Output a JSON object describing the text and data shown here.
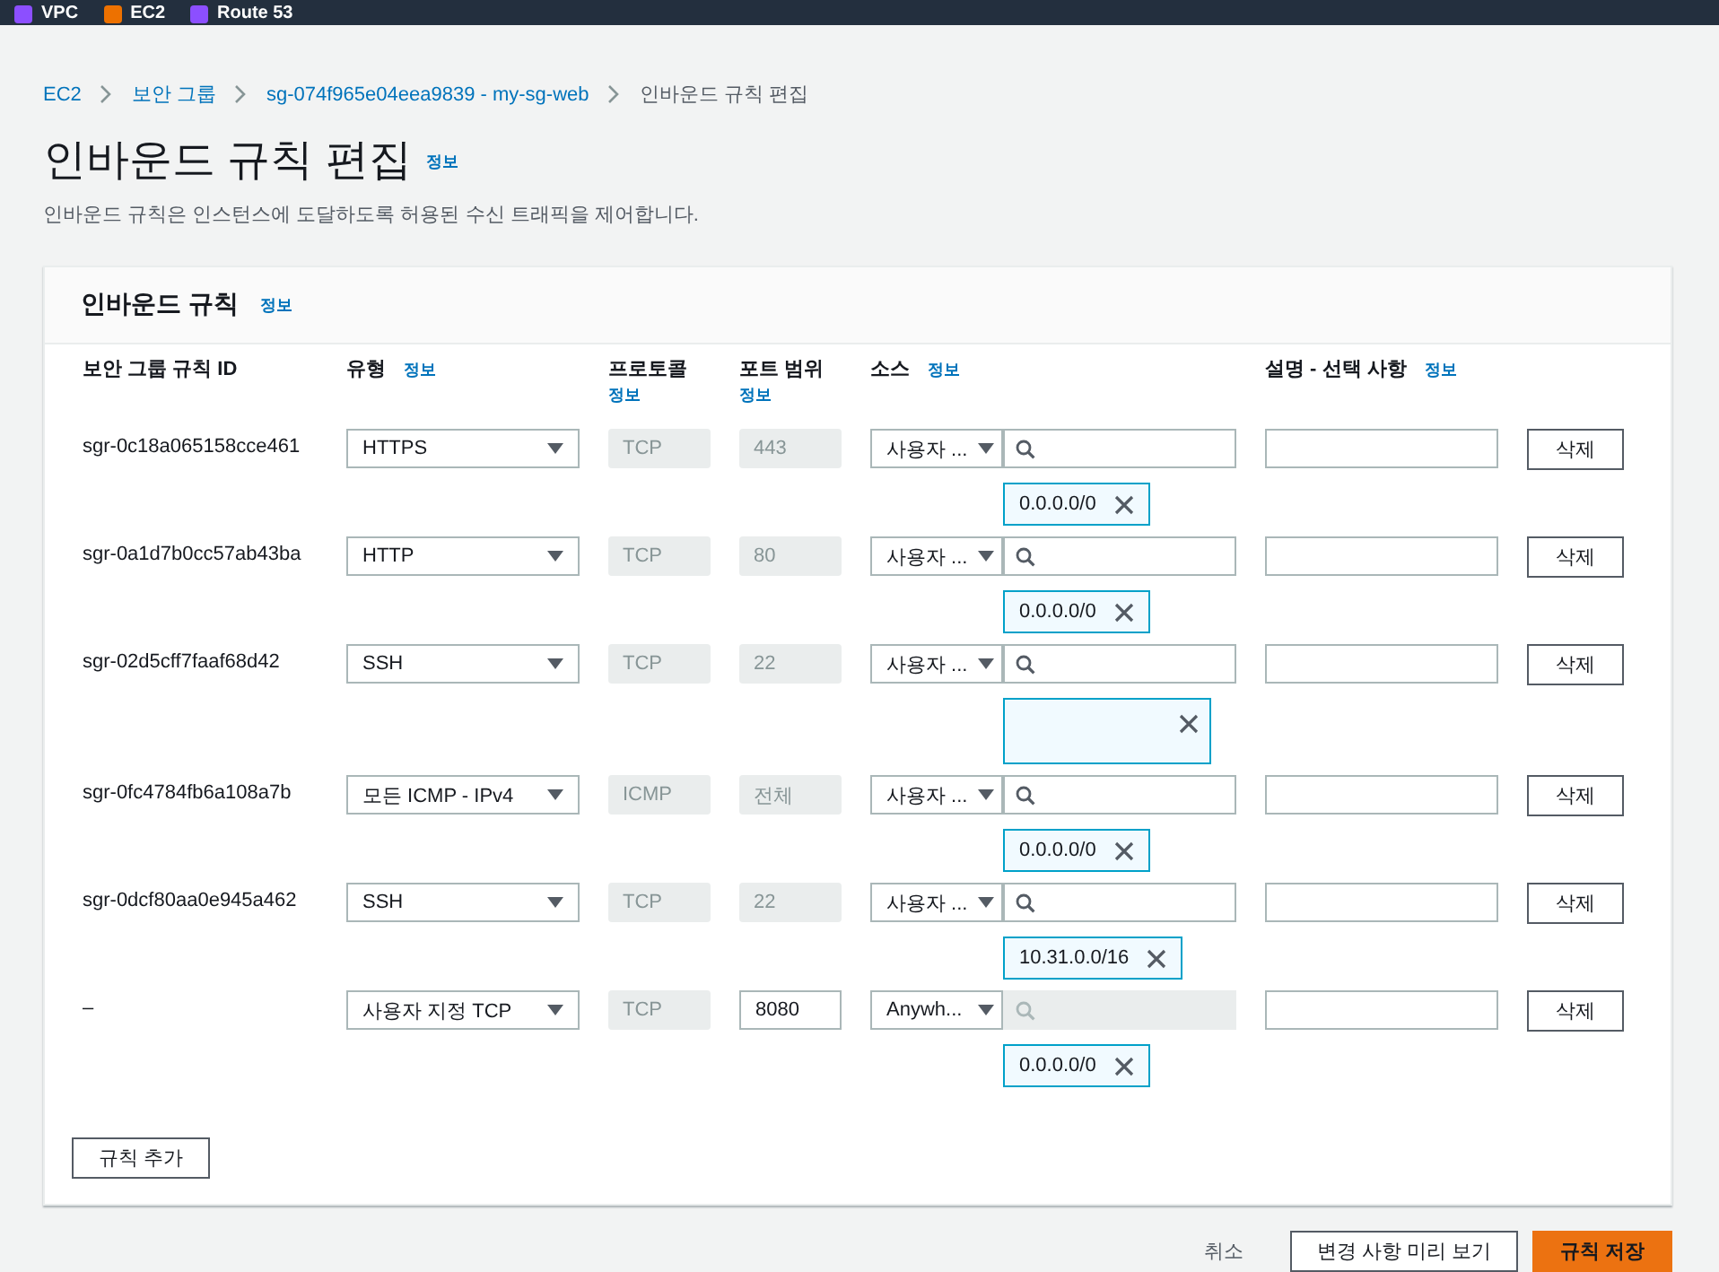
{
  "nav": {
    "items": [
      {
        "label": "VPC",
        "color": "#8c4fff"
      },
      {
        "label": "EC2",
        "color": "#ed7100"
      },
      {
        "label": "Route 53",
        "color": "#8c4fff"
      }
    ]
  },
  "breadcrumb": [
    {
      "label": "EC2",
      "link": true
    },
    {
      "label": "보안 그룹",
      "link": true
    },
    {
      "label": "sg-074f965e04eea9839 - my-sg-web",
      "link": true
    },
    {
      "label": "인바운드 규칙 편집",
      "link": false
    }
  ],
  "page": {
    "title": "인바운드 규칙 편집",
    "info": "정보",
    "description": "인바운드 규칙은 인스턴스에 도달하도록 허용된 수신 트래픽을 제어합니다."
  },
  "panel": {
    "title": "인바운드 규칙",
    "info": "정보",
    "columns": [
      {
        "label": "보안 그룹 규칙 ID"
      },
      {
        "label": "유형",
        "info": "정보"
      },
      {
        "label": "프로토콜",
        "info": "정보"
      },
      {
        "label": "포트 범위",
        "info": "정보"
      },
      {
        "label": "소스",
        "info": "정보"
      },
      {
        "label": "설명 - 선택 사항",
        "info": "정보"
      }
    ],
    "rows": [
      {
        "id": "sgr-0c18a065158cce461",
        "type": "HTTPS",
        "protocol": "TCP",
        "port": "443",
        "port_disabled": true,
        "source": "사용자 ...",
        "search_disabled": false,
        "tag": {
          "kind": "text",
          "value": "0.0.0.0/0"
        },
        "delete": "삭제"
      },
      {
        "id": "sgr-0a1d7b0cc57ab43ba",
        "type": "HTTP",
        "protocol": "TCP",
        "port": "80",
        "port_disabled": true,
        "source": "사용자 ...",
        "search_disabled": false,
        "tag": {
          "kind": "text",
          "value": "0.0.0.0/0"
        },
        "delete": "삭제"
      },
      {
        "id": "sgr-02d5cff7faaf68d42",
        "type": "SSH",
        "protocol": "TCP",
        "port": "22",
        "port_disabled": true,
        "source": "사용자 ...",
        "search_disabled": false,
        "tag": {
          "kind": "redacted"
        },
        "delete": "삭제"
      },
      {
        "id": "sgr-0fc4784fb6a108a7b",
        "type": "모든 ICMP - IPv4",
        "protocol": "ICMP",
        "port": "전체",
        "port_disabled": true,
        "source": "사용자 ...",
        "search_disabled": false,
        "tag": {
          "kind": "text",
          "value": "0.0.0.0/0"
        },
        "delete": "삭제"
      },
      {
        "id": "sgr-0dcf80aa0e945a462",
        "type": "SSH",
        "protocol": "TCP",
        "port": "22",
        "port_disabled": true,
        "source": "사용자 ...",
        "search_disabled": false,
        "tag": {
          "kind": "text",
          "value": "10.31.0.0/16"
        },
        "delete": "삭제"
      },
      {
        "id": "–",
        "type": "사용자 지정 TCP",
        "protocol": "TCP",
        "port": "8080",
        "port_disabled": false,
        "source": "Anywh...",
        "search_disabled": true,
        "tag": {
          "kind": "text",
          "value": "0.0.0.0/0"
        },
        "delete": "삭제"
      }
    ],
    "add_button": "규칙 추가"
  },
  "footer": {
    "cancel": "취소",
    "preview": "변경 사항 미리 보기",
    "save": "규칙 저장"
  }
}
